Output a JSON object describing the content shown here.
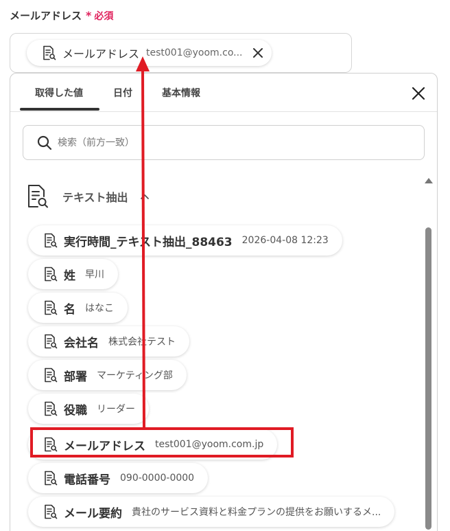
{
  "field": {
    "label": "メールアドレス",
    "asterisk": "*",
    "required": "必須",
    "selected": {
      "name": "メールアドレス",
      "value": "test001@yoom.co..."
    }
  },
  "tabs": [
    {
      "label": "取得した値",
      "active": true
    },
    {
      "label": "日付",
      "active": false
    },
    {
      "label": "基本情報",
      "active": false
    }
  ],
  "search": {
    "placeholder": "検索（前方一致）"
  },
  "group": {
    "title": "テキスト抽出"
  },
  "items": [
    {
      "name": "実行時間_テキスト抽出_88463",
      "value": "2026-04-08 12:23"
    },
    {
      "name": "姓",
      "value": "早川"
    },
    {
      "name": "名",
      "value": "はなこ"
    },
    {
      "name": "会社名",
      "value": "株式会社テスト"
    },
    {
      "name": "部署",
      "value": "マーケティング部"
    },
    {
      "name": "役職",
      "value": "リーダー"
    },
    {
      "name": "メールアドレス",
      "value": "test001@yoom.com.jp"
    },
    {
      "name": "電話番号",
      "value": "090-0000-0000"
    },
    {
      "name": "メール要約",
      "value": "貴社のサービス資料と料金プランの提供をお願いするメ..."
    }
  ],
  "colors": {
    "accent": "#e01b24",
    "required": "#e0245e",
    "text": "#333333",
    "scrollbar": "#8a8a8a"
  },
  "icons": {
    "variable": "document-search-icon",
    "close": "close-icon",
    "search": "search-icon",
    "collapse": "chevron-up-icon"
  }
}
